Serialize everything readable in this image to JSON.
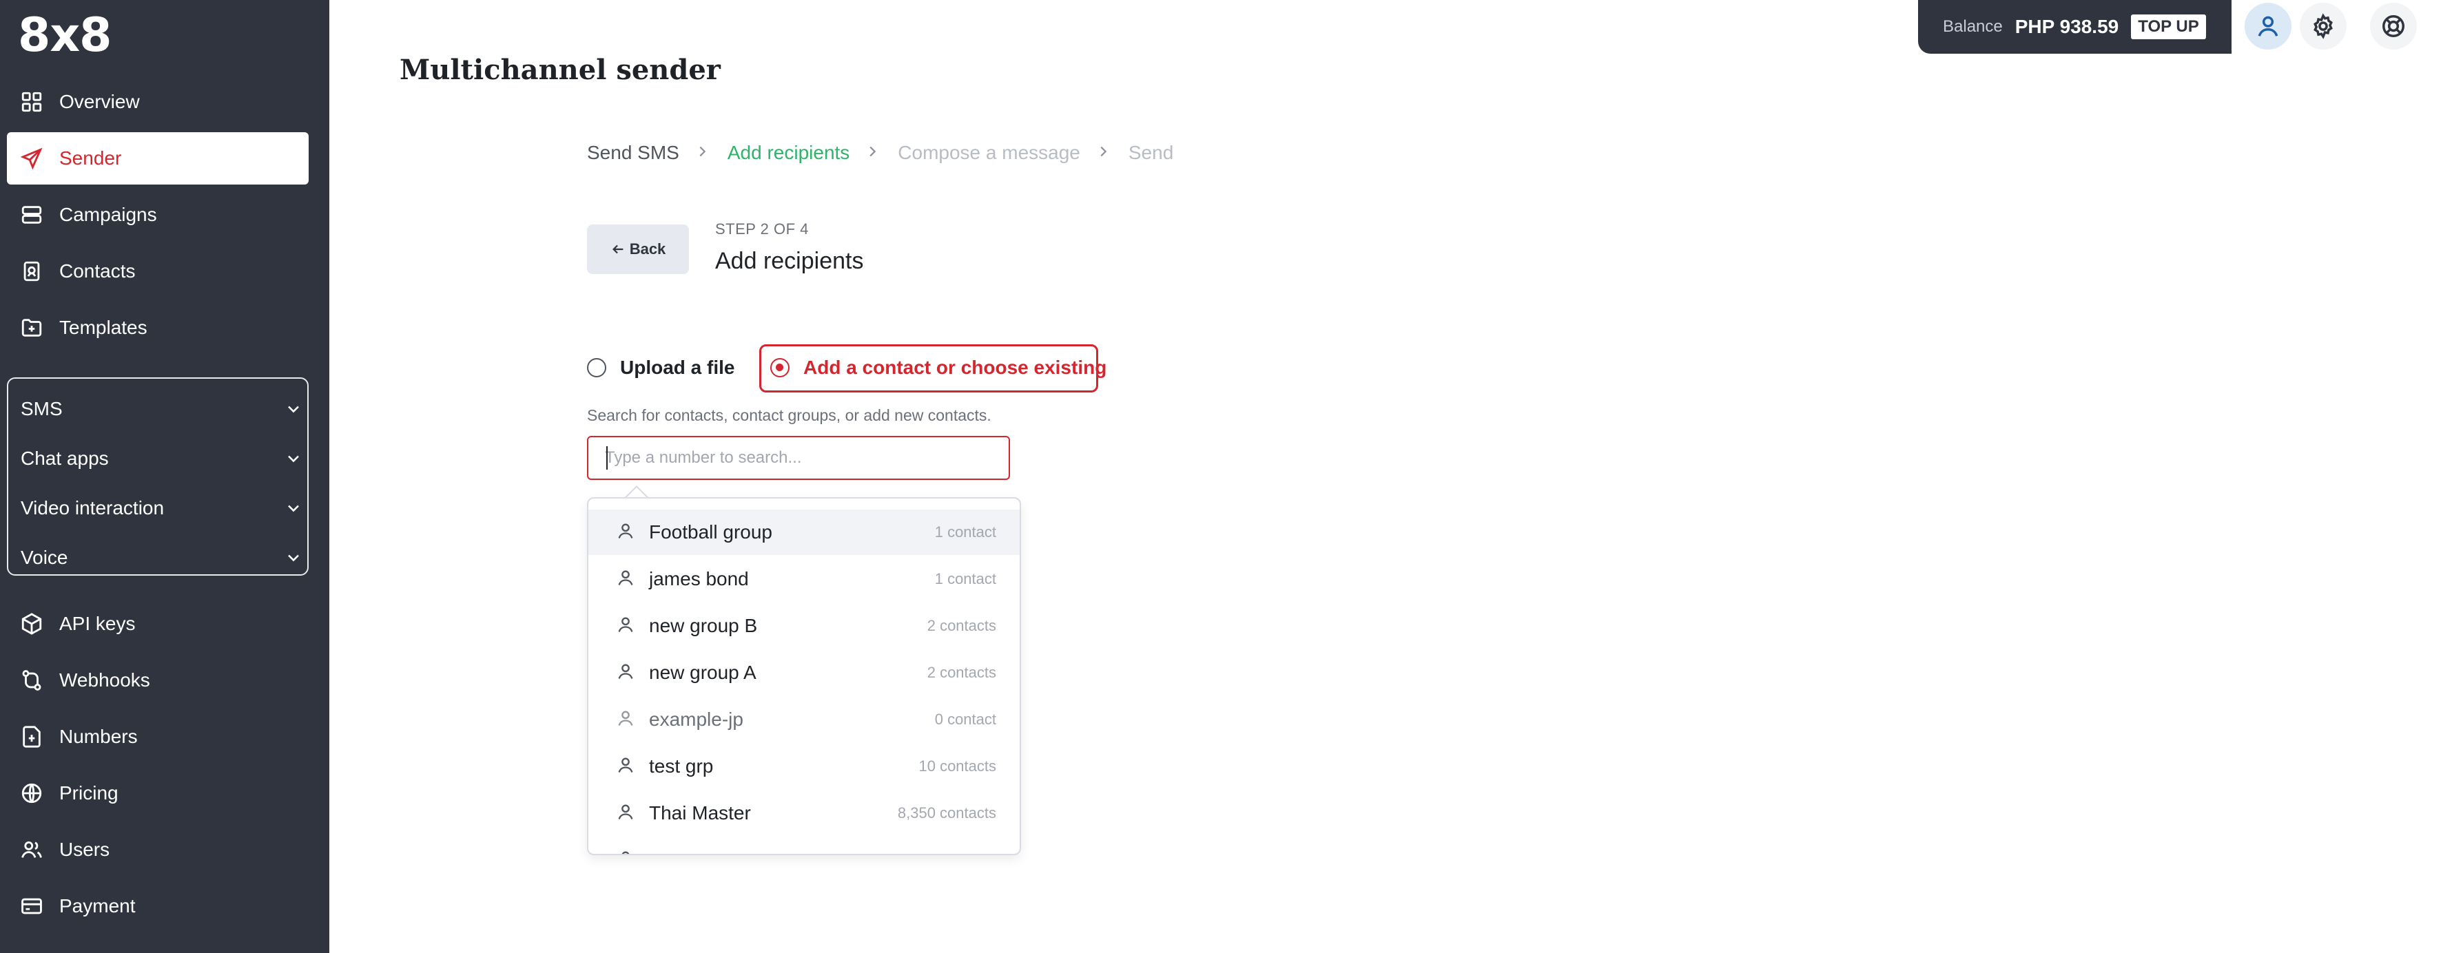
{
  "sidebar": {
    "logo": "8x8",
    "nav_top": [
      {
        "label": "Overview",
        "icon": "grid-icon"
      },
      {
        "label": "Sender",
        "icon": "send-icon",
        "active": true
      },
      {
        "label": "Campaigns",
        "icon": "campaigns-icon"
      },
      {
        "label": "Contacts",
        "icon": "contacts-icon"
      },
      {
        "label": "Templates",
        "icon": "templates-icon"
      }
    ],
    "channel_groups": [
      {
        "label": "SMS"
      },
      {
        "label": "Chat apps"
      },
      {
        "label": "Video interaction"
      },
      {
        "label": "Voice"
      }
    ],
    "nav_bottom": [
      {
        "label": "API keys",
        "icon": "cube-icon"
      },
      {
        "label": "Webhooks",
        "icon": "webhook-icon"
      },
      {
        "label": "Numbers",
        "icon": "numbers-icon"
      },
      {
        "label": "Pricing",
        "icon": "globe-icon"
      },
      {
        "label": "Users",
        "icon": "users-icon"
      },
      {
        "label": "Payment",
        "icon": "card-icon"
      }
    ]
  },
  "topbar": {
    "balance_label": "Balance",
    "balance_value": "PHP 938.59",
    "topup_label": "TOP UP"
  },
  "main": {
    "title": "Multichannel sender",
    "breadcrumbs": [
      "Send SMS",
      "Add recipients",
      "Compose a message",
      "Send"
    ],
    "back_label": "Back",
    "step_label": "STEP 2 OF 4",
    "step_title": "Add recipients",
    "options": {
      "upload": "Upload a file",
      "contact": "Add a contact or choose existing"
    },
    "help_text": "Search for contacts, contact groups, or add new contacts.",
    "search_placeholder": "Type a number to search...",
    "results": [
      {
        "name": "Football group",
        "count": "1 contact"
      },
      {
        "name": "james bond",
        "count": "1 contact"
      },
      {
        "name": "new group B",
        "count": "2 contacts"
      },
      {
        "name": "new group A",
        "count": "2 contacts"
      },
      {
        "name": "example-jp",
        "count": "0 contact"
      },
      {
        "name": "test grp",
        "count": "10 contacts"
      },
      {
        "name": "Thai Master",
        "count": "8,350 contacts"
      }
    ]
  },
  "colors": {
    "sidebar_bg": "#30343f",
    "accent_red": "#d4262e",
    "accent_green": "#2fb36b"
  }
}
